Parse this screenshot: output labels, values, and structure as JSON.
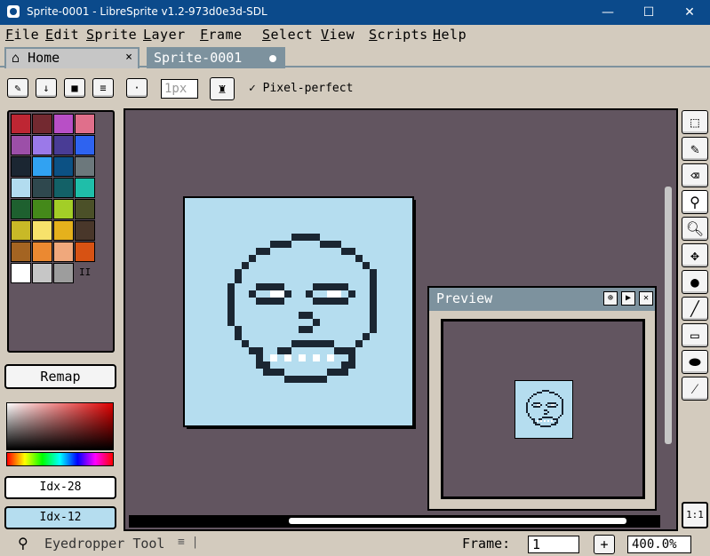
{
  "window": {
    "title": "Sprite-0001 - LibreSprite v1.2-973d0e3d-SDL",
    "minimize": "—",
    "maximize": "☐",
    "close": "✕"
  },
  "menu": [
    "File",
    "Edit",
    "Sprite",
    "Layer",
    "Frame",
    "Select",
    "View",
    "Scripts",
    "Help"
  ],
  "tabs": {
    "home": "Home",
    "home_close": "×",
    "sprite": "Sprite-0001"
  },
  "context": {
    "brush_size": "1px",
    "pixel_perfect_label": "Pixel-perfect",
    "pixel_perfect_checked": "✓"
  },
  "palette": {
    "colors": [
      "#be2633",
      "#732930",
      "#b84fc6",
      "#e06f8b",
      "#9c4fa8",
      "#9b79e9",
      "#493c95",
      "#2e63f0",
      "#1b2632",
      "#31a2f2",
      "#0c5184",
      "#6c787c",
      "#b2dcef",
      "#2f484e",
      "#136167",
      "#1fbea9",
      "#1e602f",
      "#44891a",
      "#a3ce27",
      "#4b5028",
      "#c8b927",
      "#f7e26b",
      "#e5b11c",
      "#49372a",
      "#a46422",
      "#eb8931",
      "#f0a87c",
      "#d75213",
      "#ffffff",
      "#c6c6c6",
      "#9d9d9d"
    ],
    "more": "II"
  },
  "remap_label": "Remap",
  "fg_color": "Idx-28",
  "bg_color": "Idx-12",
  "preview": {
    "title": "Preview"
  },
  "status": {
    "tool_name": "Eyedropper Tool",
    "extra": "≡ |",
    "frame_label": "Frame:",
    "frame_value": "1",
    "add_frame": "+",
    "zoom": "400.0%"
  },
  "one_to_one": "1:1",
  "colors": {
    "accent": "#7d929e",
    "sprite_bg": "#b5ddef",
    "workspace": "#625560",
    "face": "#1b2632"
  }
}
